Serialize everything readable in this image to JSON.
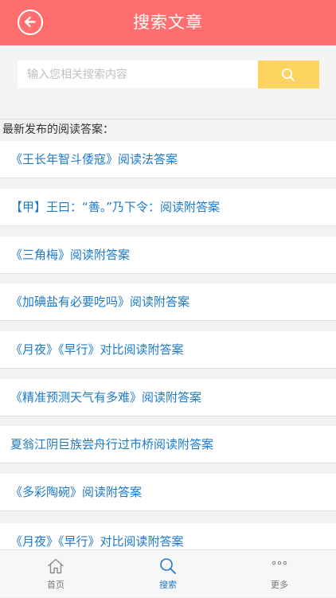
{
  "header": {
    "title": "搜索文章",
    "back_icon": "back-arrow-circle-icon"
  },
  "search": {
    "placeholder": "输入您相关搜索内容",
    "value": "",
    "button_icon": "search-icon"
  },
  "section": {
    "label": "最新发布的阅读答案："
  },
  "articles": [
    "《王长年智斗倭寇》阅读法答案",
    "【甲】王曰：“善。”乃下令：阅读附答案",
    "《三角梅》阅读附答案",
    "《加碘盐有必要吃吗》阅读附答案",
    "《月夜》《早行》对比阅读附答案",
    "《精准预测天气有多难》阅读附答案",
    "夏翁江阴巨族尝舟行过市桥阅读附答案",
    "《多彩陶碗》阅读附答案",
    "《月夜》《早行》对比阅读附答案"
  ],
  "tabbar": {
    "items": [
      {
        "label": "首页",
        "icon": "home-icon",
        "active": false
      },
      {
        "label": "搜索",
        "icon": "search-icon",
        "active": true
      },
      {
        "label": "更多",
        "icon": "more-dots-icon",
        "active": false
      }
    ]
  },
  "colors": {
    "header_bg": "#ff6f6f",
    "search_button_bg": "#fcd35e",
    "link_text": "#1d7ac9",
    "active_tab": "#1d7ac9"
  }
}
